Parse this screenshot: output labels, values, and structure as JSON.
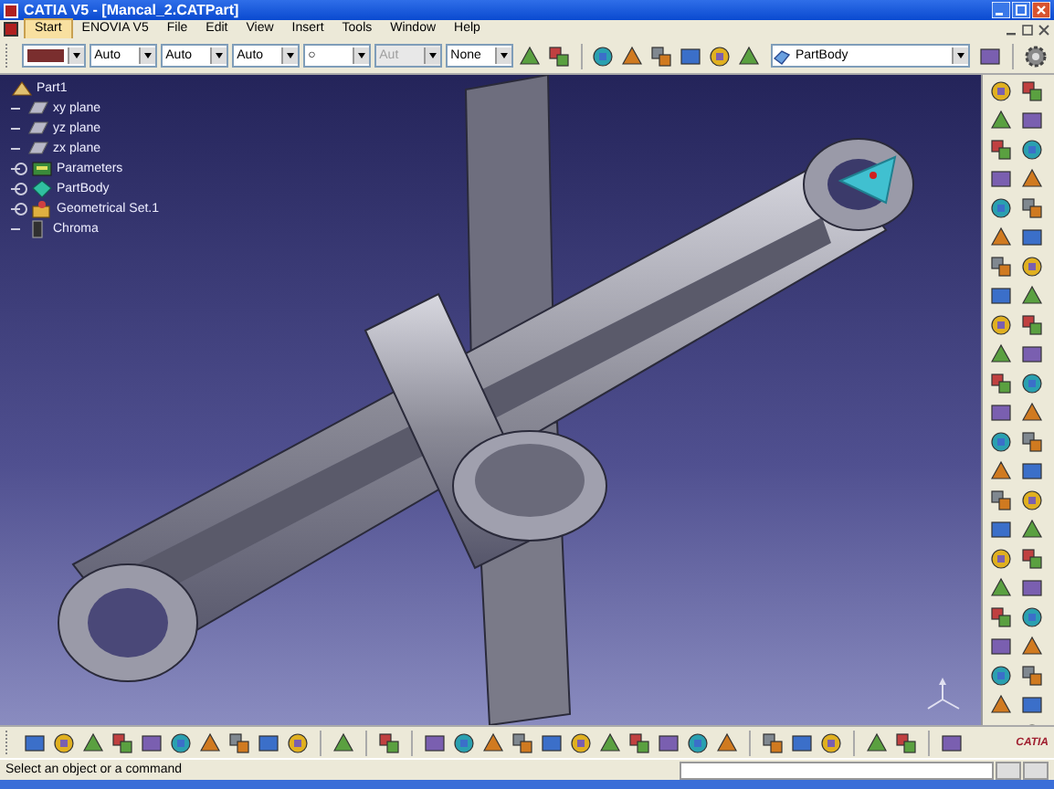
{
  "window": {
    "title": "CATIA V5 - [Mancal_2.CATPart]"
  },
  "menu": [
    {
      "label": "Start",
      "selected": true
    },
    {
      "label": "ENOVIA V5",
      "selected": false
    },
    {
      "label": "File",
      "selected": false
    },
    {
      "label": "Edit",
      "selected": false
    },
    {
      "label": "View",
      "selected": false
    },
    {
      "label": "Insert",
      "selected": false
    },
    {
      "label": "Tools",
      "selected": false
    },
    {
      "label": "Window",
      "selected": false
    },
    {
      "label": "Help",
      "selected": false
    }
  ],
  "graphic_toolbar": {
    "dropdowns": [
      {
        "kind": "swatch",
        "disabled": false
      },
      {
        "kind": "text",
        "value": "Auto",
        "disabled": false
      },
      {
        "kind": "text",
        "value": "Auto",
        "disabled": false
      },
      {
        "kind": "text",
        "value": "Auto",
        "disabled": false
      },
      {
        "kind": "text",
        "value": "○",
        "disabled": false
      },
      {
        "kind": "text",
        "value": "Aut",
        "disabled": true
      },
      {
        "kind": "text",
        "value": "None",
        "disabled": false
      }
    ],
    "work_object": "PartBody"
  },
  "tree": {
    "label": "Part1",
    "children": [
      {
        "label": "xy plane",
        "kind": "plane",
        "expandable": false
      },
      {
        "label": "yz plane",
        "kind": "plane",
        "expandable": false
      },
      {
        "label": "zx plane",
        "kind": "plane",
        "expandable": false
      },
      {
        "label": "Parameters",
        "kind": "parameters",
        "expandable": true
      },
      {
        "label": "PartBody",
        "kind": "body",
        "expandable": true
      },
      {
        "label": "Geometrical Set.1",
        "kind": "set",
        "expandable": true
      },
      {
        "label": "Chroma",
        "kind": "chroma",
        "expandable": false
      }
    ]
  },
  "logo": "CATIA",
  "status_bar": {
    "message": "Select an object or a command"
  }
}
